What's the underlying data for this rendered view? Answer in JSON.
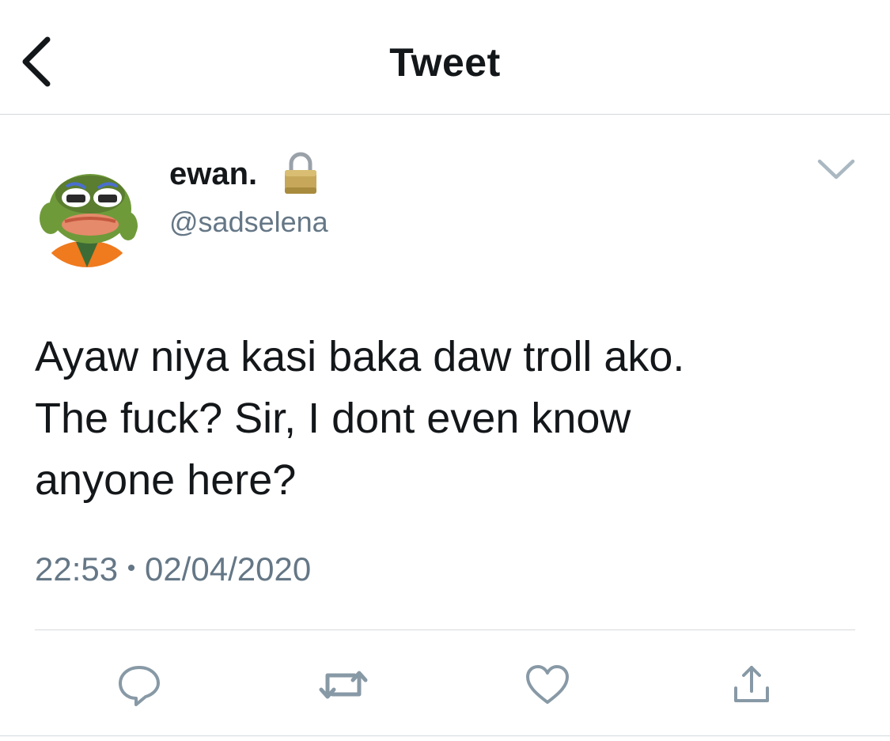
{
  "header": {
    "title": "Tweet",
    "back_icon": "chevron-left-icon"
  },
  "tweet": {
    "author": {
      "display_name": "ewan.",
      "handle": "@sadselena",
      "protected_icon": "lock-icon"
    },
    "menu_icon": "chevron-down-icon",
    "text_lines": [
      "Ayaw niya kasi baka daw troll ako.",
      "The fuck? Sir, I dont even know",
      "anyone here?"
    ],
    "time": "22:53",
    "separator": "•",
    "date": "02/04/2020"
  },
  "actions": [
    {
      "name": "reply",
      "icon": "reply-icon"
    },
    {
      "name": "retweet",
      "icon": "retweet-icon"
    },
    {
      "name": "like",
      "icon": "heart-icon"
    },
    {
      "name": "share",
      "icon": "share-icon"
    }
  ],
  "colors": {
    "text": "#14171a",
    "secondary": "#657786",
    "divider": "#d5d9dc",
    "action_icon": "#8899a6"
  }
}
